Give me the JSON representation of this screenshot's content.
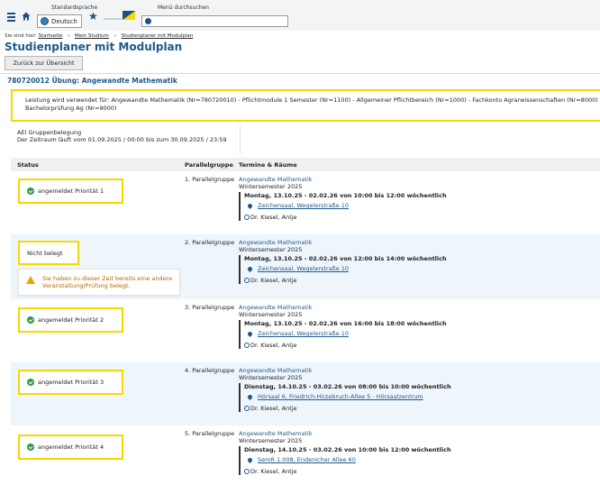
{
  "header": {
    "lang_label": "Standardsprache",
    "lang_value": "Deutsch",
    "menu_search_label": "Menü durchsuchen",
    "menu_search_placeholder": ""
  },
  "breadcrumb": {
    "prefix": "Sie sind hier:",
    "items": [
      "Startseite",
      "Mein Studium",
      "Studienplaner mit Modulplan"
    ]
  },
  "page_title": "Studienplaner mit Modulplan",
  "back_button": "Zurück zur Übersicht",
  "event_title": "780720012 Übung: Angewandte Mathematik",
  "info_text": "Leistung wird verwendet für: Angewandte Mathematik (Nr=780720010) - Pflichtmodule 1 Semester (Nr=1100) - Allgemeiner Pflichtbereich (Nr=1000) - Fachkonto Agrarwissenschaften (Nr=8000) - Bachelorprüfung Ag (Nr=9000)",
  "group_info": {
    "line1": "AEI Gruppenbelegung",
    "line2": "Der Zeitraum läuft vom 01.09.2025 / 00:00 bis zum 30.09.2025 / 23:59"
  },
  "table": {
    "headers": [
      "Status",
      "Parallelgruppe",
      "Termine & Räume"
    ],
    "rows": [
      {
        "status": "angemeldet Priorität 1",
        "group": "1. Parallelgruppe",
        "course": "Angewandte Mathematik",
        "semester": "Wintersemester 2025",
        "schedule": "Montag, 13.10.25 - 02.02.26 von 10:00 bis 12:00 wöchentlich",
        "room": "Zeichensaal, Wegelerstraße 10",
        "lecturer": "Dr. Kiesel, Antje"
      },
      {
        "status": "Nicht belegt",
        "warning": "Sie haben zu dieser Zeit bereits eine andere Veranstaltung/Prüfung belegt.",
        "group": "2. Parallelgruppe",
        "course": "Angewandte Mathematik",
        "semester": "Wintersemester 2025",
        "schedule": "Montag, 13.10.25 - 02.02.26 von 12:00 bis 14:00 wöchentlich",
        "room": "Zeichensaal, Wegelerstraße 10",
        "lecturer": "Dr. Kiesel, Antje"
      },
      {
        "status": "angemeldet Priorität 2",
        "group": "3. Parallelgruppe",
        "course": "Angewandte Mathematik",
        "semester": "Wintersemester 2025",
        "schedule": "Montag, 13.10.25 - 02.02.26 von 16:00 bis 18:00 wöchentlich",
        "room": "Zeichensaal, Wegelerstraße 10",
        "lecturer": "Dr. Kiesel, Antje"
      },
      {
        "status": "angemeldet Priorität 3",
        "group": "4. Parallelgruppe",
        "course": "Angewandte Mathematik",
        "semester": "Wintersemester 2025",
        "schedule": "Dienstag, 14.10.25 - 03.02.26 von 08:00 bis 10:00 wöchentlich",
        "room": "Hörsaal 6, Friedrich-Hirzebruch-Allee 5 - Hörsaalzentrum",
        "lecturer": "Dr. Kiesel, Antje"
      },
      {
        "status": "angemeldet Priorität 4",
        "group": "5. Parallelgruppe",
        "course": "Angewandte Mathematik",
        "semester": "Wintersemester 2025",
        "schedule": "Dienstag, 14.10.25 - 03.02.26 von 10:00 bis 12:00 wöchentlich",
        "room": "SemR 1.008, Endenicher Allee 60",
        "lecturer": "Dr. Kiesel, Antje"
      }
    ]
  },
  "colors": {
    "brand": "#1c5a8c",
    "highlight_border": "#f5d800",
    "success": "#2e9a3d",
    "warning": "#e9a400",
    "alt_row": "#eef5fb"
  }
}
